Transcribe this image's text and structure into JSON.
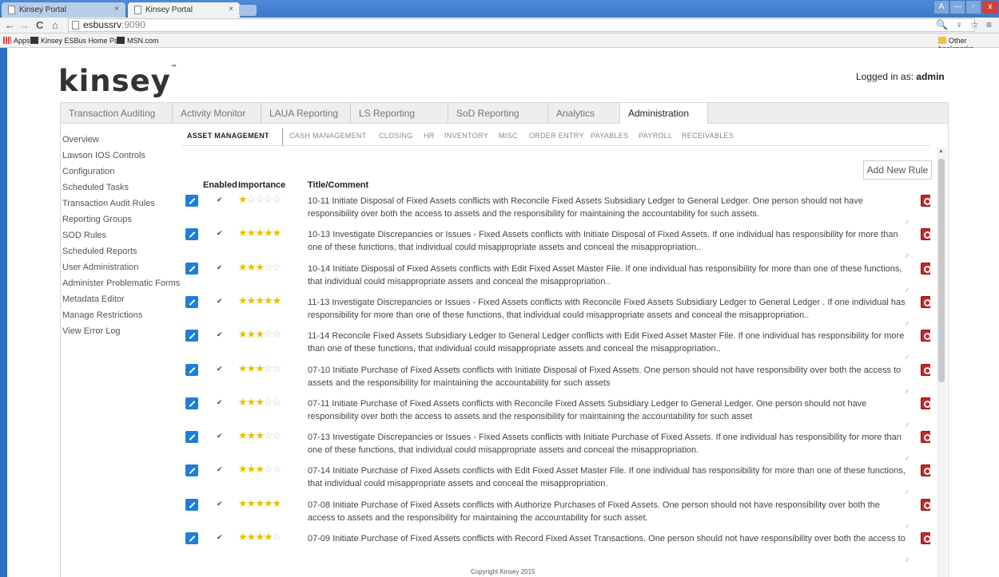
{
  "browser": {
    "tabs": [
      {
        "title": "Kinsey Portal",
        "close": "×"
      },
      {
        "title": "Kinsey Portal",
        "close": "×"
      }
    ],
    "url_host": "esbussrv",
    "url_port": ":9090",
    "nav": {
      "back": "←",
      "forward": "→",
      "reload": "C",
      "home": "⌂"
    },
    "addr_icons": "🔍 ♀ ☆ ≡",
    "window_controls": {
      "user": "A",
      "minimize": "—",
      "maximize": "▫",
      "close": "x"
    },
    "bookmarks": {
      "apps": "Apps",
      "items": [
        "Kinsey ESBus Home Pa...",
        "MSN.com"
      ],
      "other": "Other bookmarks"
    }
  },
  "header": {
    "logo": "kinsey",
    "logo_mark": "™",
    "logged_in_label": "Logged in as:",
    "logged_in_user": "admin"
  },
  "topnav": [
    "Transaction Auditing",
    "Activity Monitor",
    "LAUA Reporting",
    "LS Reporting",
    "SoD Reporting",
    "Analytics",
    "Administration"
  ],
  "topnav_active": "Administration",
  "sidebar": [
    "Overview",
    "Lawson IOS Controls",
    "Configuration",
    "Scheduled Tasks",
    "Transaction Audit Rules",
    "Reporting Groups",
    "SOD Rules",
    "Scheduled Reports",
    "User Administration",
    "Administer Problematic Forms",
    "Metadata Editor",
    "Manage Restrictions",
    "View Error Log"
  ],
  "subnav": [
    "ASSET MANAGEMENT",
    "CASH MANAGEMENT",
    "CLOSING",
    "HR",
    "INVENTORY",
    "MISC",
    "ORDER ENTRY",
    "PAYABLES",
    "PAYROLL",
    "RECEIVABLES"
  ],
  "subnav_active": "ASSET MANAGEMENT",
  "add_new_rule": "Add New Rule",
  "columns": {
    "enabled": "Enabled",
    "importance": "Importance",
    "title": "Title/Comment"
  },
  "rules": [
    {
      "enabled": true,
      "importance": 1,
      "text": "10-11 Initiate Disposal of Fixed Assets conflicts with Reconcile Fixed Assets Subsidiary Ledger to General Ledger. One person should not have responsibility over both the access to assets and the responsibility for maintaining the accountability for such assets."
    },
    {
      "enabled": true,
      "importance": 5,
      "text": "10-13 Investigate Discrepancies or Issues - Fixed Assets conflicts with Initiate Disposal of Fixed Assets. If one individual has responsibility for more than one of these functions, that individual could misappropriate assets and conceal the misappropriation.."
    },
    {
      "enabled": true,
      "importance": 3,
      "text": "10-14 Initiate Disposal of Fixed Assets conflicts with Edit Fixed Asset Master File. If one individual has responsibility for more than one of these functions, that individual could misappropriate assets and conceal the misappropriation.."
    },
    {
      "enabled": true,
      "importance": 5,
      "text": "11-13 Investigate Discrepancies or Issues - Fixed Assets conflicts with Reconcile Fixed Assets Subsidiary Ledger to General Ledger . If one individual has responsibility for more than one of these functions, that individual could misappropriate assets and conceal the misappropriation.."
    },
    {
      "enabled": true,
      "importance": 3,
      "text": "11-14 Reconcile Fixed Assets Subsidiary Ledger to General Ledger conflicts with Edit Fixed Asset Master File. If one individual has responsibility for more than one of these functions, that individual could misappropriate assets and conceal the misappropriation.."
    },
    {
      "enabled": true,
      "importance": 3,
      "text": "07-10 Initiate Purchase of Fixed Assets conflicts with Initiate Disposal of Fixed Assets. One person should not have responsibility over both the access to assets and the responsibility for maintaining the accountability for such assets"
    },
    {
      "enabled": true,
      "importance": 3,
      "text": "07-11 Initiate Purchase of Fixed Assets conflicts with Reconcile Fixed Assets Subsidiary Ledger to General Ledger. One person should not have responsibility over both the access to assets and the responsibility for maintaining the accountability for such asset"
    },
    {
      "enabled": true,
      "importance": 3,
      "text": "07-13 Investigate Discrepancies or Issues - Fixed Assets conflicts with Initiate Purchase of Fixed Assets. If one individual has responsibility for more than one of these functions, that individual could misappropriate assets and conceal the misappropriation."
    },
    {
      "enabled": true,
      "importance": 3,
      "text": "07-14 Initiate Purchase of Fixed Assets conflicts with Edit Fixed Asset Master File. If one individual has responsibility for more than one of these functions, that individual could misappropriate assets and conceal the misappropriation."
    },
    {
      "enabled": true,
      "importance": 5,
      "text": "07-08 Initiate Purchase of Fixed Assets conflicts with Authorize Purchases of Fixed Assets. One person should not have responsibility over both the access to assets and the responsibility for maintaining the accountability for such asset."
    },
    {
      "enabled": true,
      "importance": 4,
      "text": "07-09 Initiate Purchase of Fixed Assets conflicts with Record Fixed Asset Transactions. One person should not have responsibility over both the access to"
    }
  ],
  "footer": "Copyright Kinsey 2015",
  "colors": {
    "star_on": "#e8c100",
    "star_off": "#c8c8c8",
    "edit": "#1e7ed8",
    "delete": "#c92626"
  }
}
